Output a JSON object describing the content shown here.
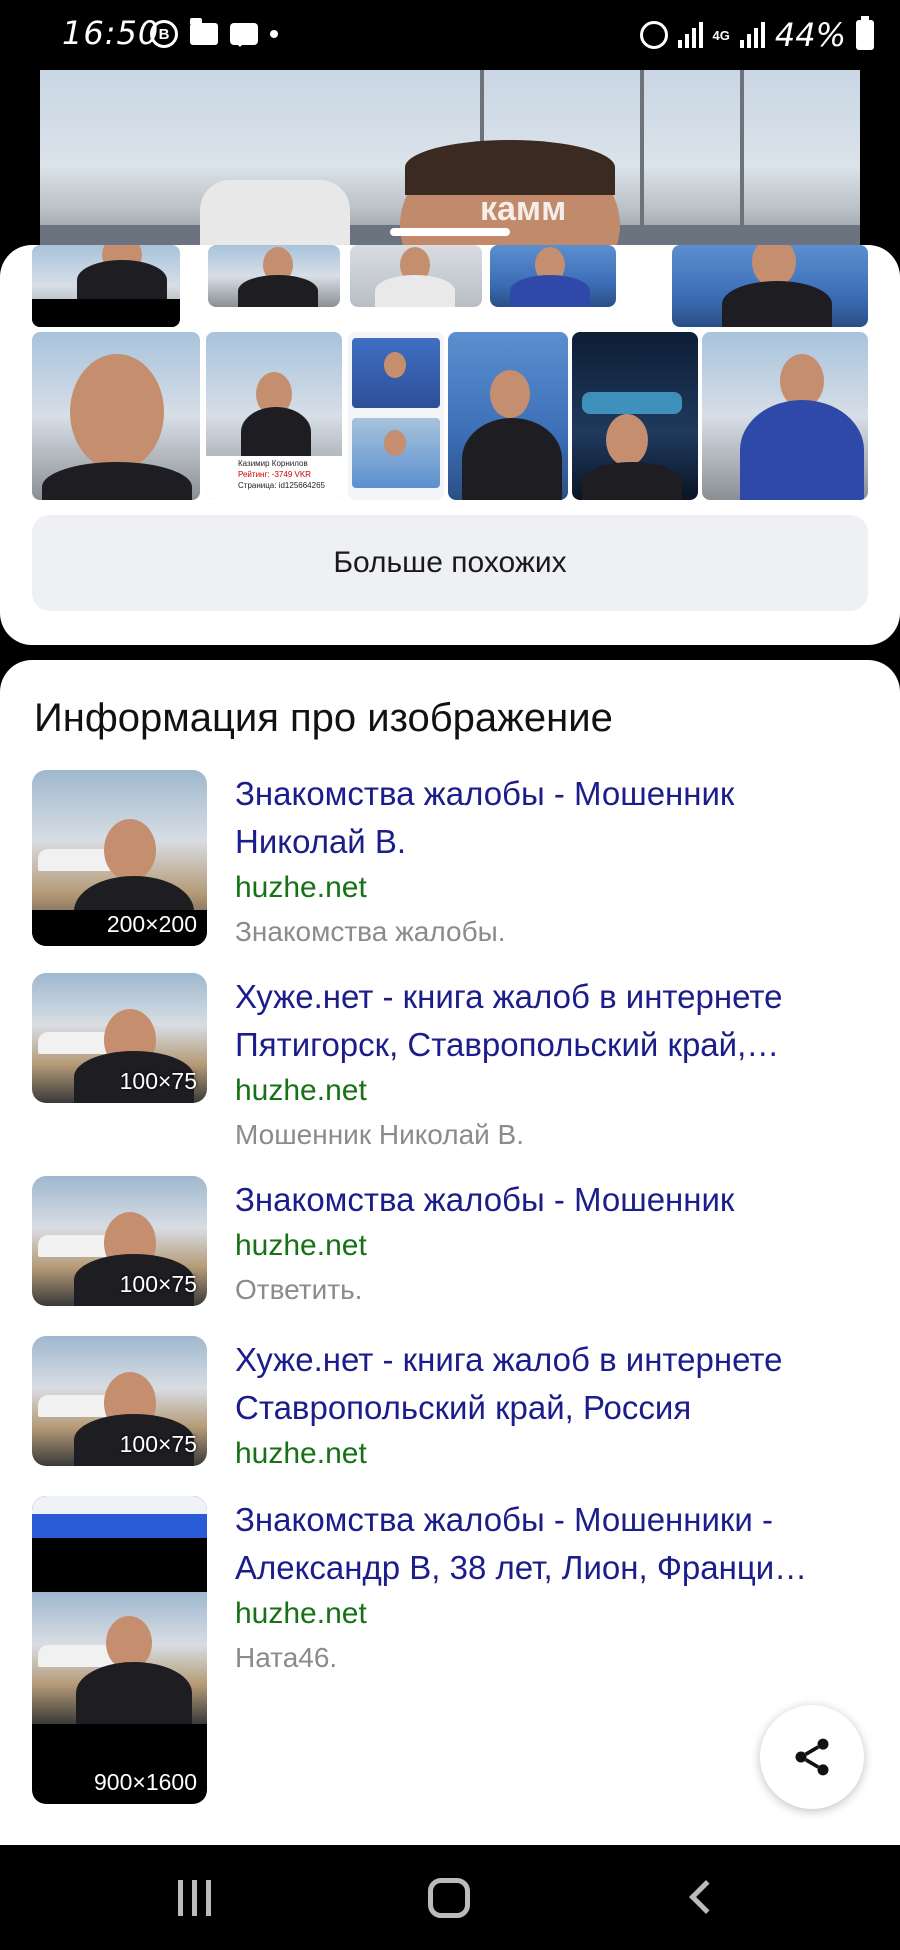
{
  "status_bar": {
    "time": "16:50",
    "b_icon_letter": "B",
    "network": "4G",
    "battery": "44%"
  },
  "preview": {
    "overlay_text": "камм"
  },
  "similar": {
    "more_button": "Больше похожих",
    "thumb_caption": [
      "Казимир Корнилов",
      "Рейтинг: -3749 VKR",
      "Страница: id125664265"
    ]
  },
  "info": {
    "title": "Информация про изображение",
    "results": [
      {
        "title": "Знакомства жалобы - Мошенник Николай В.",
        "domain": "huzhe.net",
        "snippet": "Знакомства жалобы.",
        "size": "200×200"
      },
      {
        "title": "Хуже.нет - книга жалоб в интернете Пятигорск, Ставропольский край,…",
        "domain": "huzhe.net",
        "snippet": "Мошенник Николай В.",
        "size": "100×75"
      },
      {
        "title": "Знакомства жалобы - Мошенник",
        "domain": "huzhe.net",
        "snippet": "Ответить.",
        "size": "100×75"
      },
      {
        "title": "Хуже.нет - книга жалоб в интернете Ставропольский край, Россия",
        "domain": "huzhe.net",
        "snippet": "",
        "size": "100×75"
      },
      {
        "title": "Знакомства жалобы - Мошенники - Александр В, 38 лет, Лион, Франци…",
        "domain": "huzhe.net",
        "snippet": "Ната46.",
        "size": "900×1600"
      }
    ]
  },
  "icons": {
    "share": "share-icon",
    "nav_recent": "recent-apps-icon",
    "nav_home": "home-icon",
    "nav_back": "back-icon"
  },
  "colors": {
    "link": "#1b1e8a",
    "domain": "#177116",
    "snippet": "#8b8b8b",
    "button_bg": "#eef0f3"
  }
}
